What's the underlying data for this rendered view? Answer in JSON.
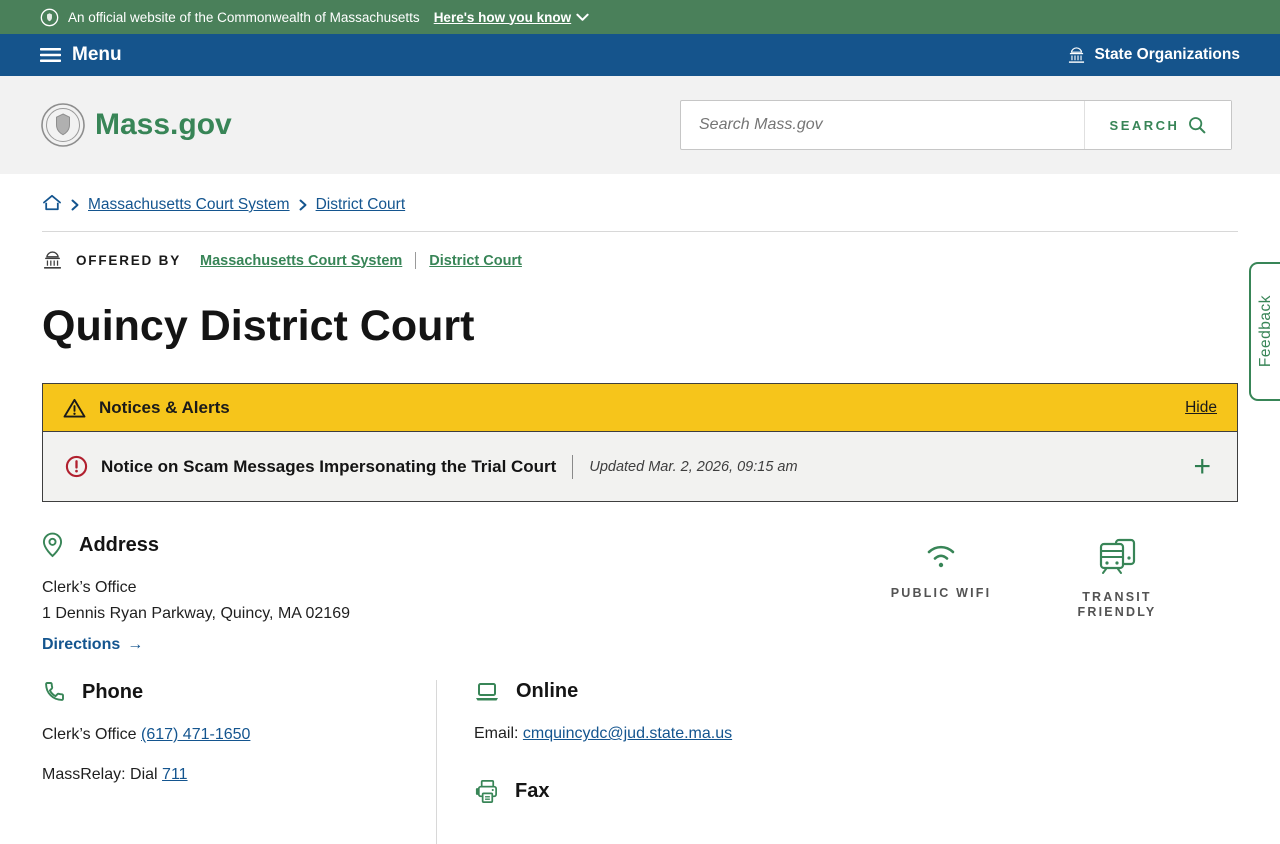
{
  "colors": {
    "banner_green": "#4a805a",
    "nav_blue": "#15548c",
    "brand_green": "#388557",
    "link_blue": "#14558f",
    "alert_yellow": "#f6c51b",
    "alert_red": "#b1202e"
  },
  "banner": {
    "official_text": "An official website of the Commonwealth of Massachusetts",
    "how_you_know": "Here's how you know"
  },
  "navbar": {
    "menu": "Menu",
    "state_organizations": "State Organizations"
  },
  "header": {
    "logo": "Mass.gov",
    "search_placeholder": "Search Mass.gov",
    "search_button": "SEARCH"
  },
  "breadcrumb": {
    "items": [
      {
        "label": "Massachusetts Court System"
      },
      {
        "label": "District Court"
      }
    ]
  },
  "offered_by": {
    "label": "OFFERED BY",
    "links": [
      {
        "label": "Massachusetts Court System"
      },
      {
        "label": "District Court"
      }
    ]
  },
  "page": {
    "title": "Quincy District Court"
  },
  "notices": {
    "title": "Notices & Alerts",
    "hide": "Hide",
    "item": {
      "title": "Notice on Scam Messages Impersonating the Trial Court",
      "updated": "Updated Mar. 2, 2026, 09:15 am",
      "expand": "+"
    }
  },
  "address": {
    "heading": "Address",
    "office": "Clerk’s Office",
    "street": "1 Dennis Ryan Parkway, Quincy, MA 02169",
    "directions": "Directions",
    "arrow": "→"
  },
  "amenities": [
    {
      "label": "PUBLIC WIFI"
    },
    {
      "label": "TRANSIT FRIENDLY"
    }
  ],
  "phone": {
    "heading": "Phone",
    "office_label": "Clerk’s Office",
    "office_number": "(617) 471-1650",
    "massrelay_label": "MassRelay: Dial",
    "massrelay_number": "711"
  },
  "online": {
    "heading": "Online",
    "email_label": "Email:",
    "email": "cmquincydc@jud.state.ma.us"
  },
  "fax": {
    "heading": "Fax"
  },
  "feedback": {
    "label": "Feedback"
  }
}
